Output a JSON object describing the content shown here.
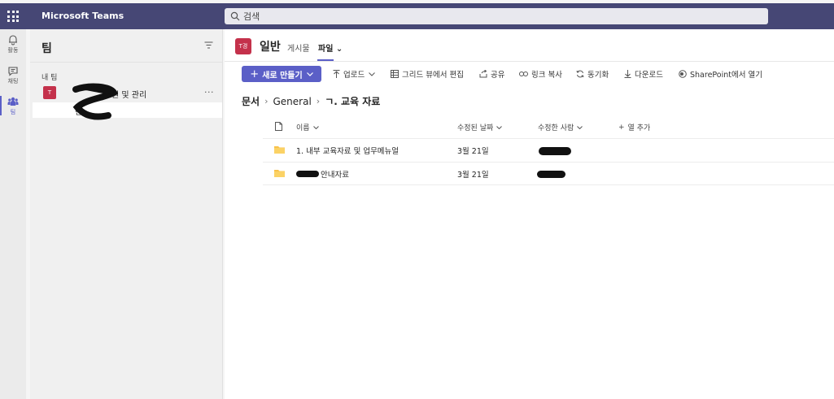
{
  "app": {
    "title": "Microsoft Teams"
  },
  "search": {
    "placeholder": "검색"
  },
  "rail": [
    {
      "label": "활동",
      "icon": "bell-icon"
    },
    {
      "label": "채팅",
      "icon": "chat-icon"
    },
    {
      "label": "팀",
      "icon": "teams-icon"
    }
  ],
  "sidebar": {
    "title": "팀",
    "section_label": "내 팀",
    "team": {
      "avatar": "T",
      "name": "원 및 관리",
      "more": "···"
    },
    "channel": {
      "name": "반"
    }
  },
  "channel_header": {
    "avatar": "T경",
    "title": "일반",
    "tabs": [
      {
        "label": "게시물"
      },
      {
        "label": "파일 ⌄"
      }
    ]
  },
  "commands": {
    "new_label": "새로 만들기",
    "upload": "업로드",
    "grid_edit": "그리드 뷰에서 편집",
    "share": "공유",
    "copy_link": "링크 복사",
    "sync": "동기화",
    "download": "다운로드",
    "open_sharepoint": "SharePoint에서 열기"
  },
  "breadcrumb": [
    "문서",
    "General",
    "ㄱ. 교육 자료"
  ],
  "table": {
    "columns": {
      "name": "이름",
      "modified": "수정된 날짜",
      "modified_by": "수정한 사람",
      "add_column": "열 추가"
    },
    "rows": [
      {
        "name": "1. 내부 교육자료 및 업무메뉴얼",
        "modified": "3월 21일"
      },
      {
        "name": "안내자료",
        "modified": "3월 21일"
      }
    ]
  },
  "colors": {
    "brand": "#464775",
    "accent": "#5b5fc7",
    "avatar": "#c4314b",
    "folder": "#f8c24a"
  }
}
